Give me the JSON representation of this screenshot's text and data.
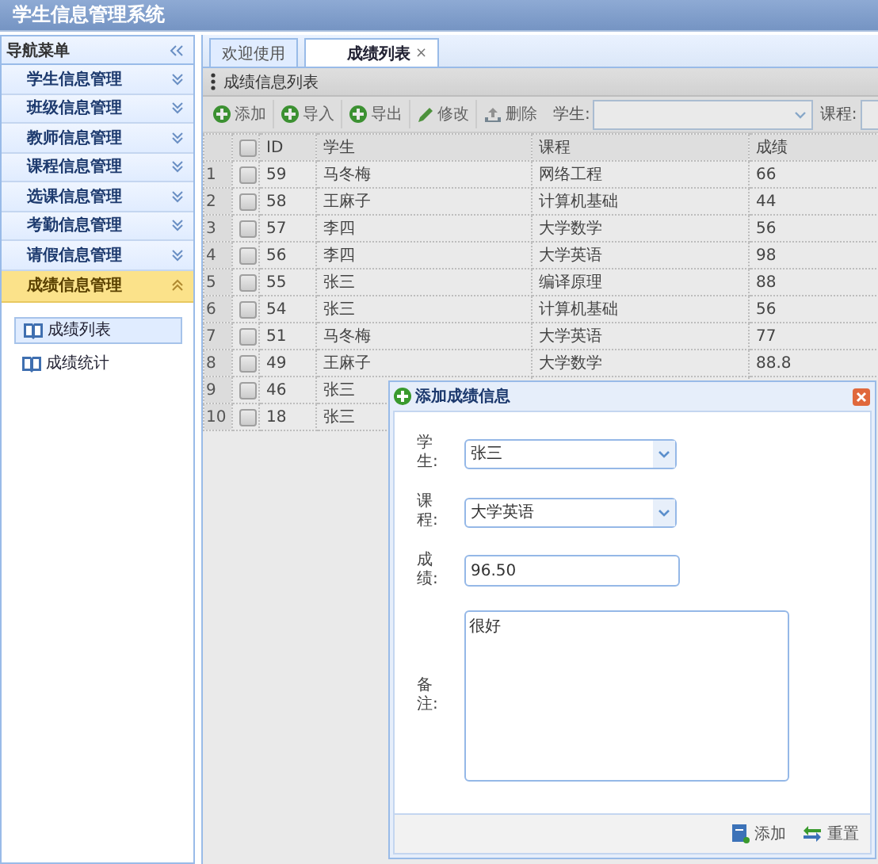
{
  "header": {
    "title": "学生信息管理系统"
  },
  "sidebar": {
    "title": "导航菜单",
    "items": [
      {
        "label": "学生信息管理",
        "expanded": false
      },
      {
        "label": "班级信息管理",
        "expanded": false
      },
      {
        "label": "教师信息管理",
        "expanded": false
      },
      {
        "label": "课程信息管理",
        "expanded": false
      },
      {
        "label": "选课信息管理",
        "expanded": false
      },
      {
        "label": "考勤信息管理",
        "expanded": false
      },
      {
        "label": "请假信息管理",
        "expanded": false
      },
      {
        "label": "成绩信息管理",
        "expanded": true,
        "children": [
          {
            "label": "成绩列表",
            "selected": true
          },
          {
            "label": "成绩统计",
            "selected": false
          }
        ]
      }
    ]
  },
  "tabs": [
    {
      "label": "欢迎使用",
      "selected": false
    },
    {
      "label": "成绩列表",
      "selected": true,
      "close": "×"
    }
  ],
  "panel": {
    "title": "成绩信息列表"
  },
  "toolbar": {
    "buttons": [
      {
        "label": "添加",
        "kind": "add"
      },
      {
        "label": "导入",
        "kind": "add"
      },
      {
        "label": "导出",
        "kind": "add"
      },
      {
        "label": "修改",
        "kind": "edit"
      },
      {
        "label": "删除",
        "kind": "delete"
      }
    ],
    "filters": [
      {
        "label": "学生:"
      },
      {
        "label": "课程:"
      }
    ]
  },
  "table": {
    "select_all_checked": false,
    "columns": [
      "ID",
      "学生",
      "课程",
      "成绩"
    ],
    "rows": [
      {
        "number": "1",
        "checked": false,
        "id": "59",
        "student": "马冬梅",
        "course": "网络工程",
        "score": "66"
      },
      {
        "number": "2",
        "checked": false,
        "id": "58",
        "student": "王麻子",
        "course": "计算机基础",
        "score": "44"
      },
      {
        "number": "3",
        "checked": false,
        "id": "57",
        "student": "李四",
        "course": "大学数学",
        "score": "56"
      },
      {
        "number": "4",
        "checked": false,
        "id": "56",
        "student": "李四",
        "course": "大学英语",
        "score": "98"
      },
      {
        "number": "5",
        "checked": false,
        "id": "55",
        "student": "张三",
        "course": "编译原理",
        "score": "88"
      },
      {
        "number": "6",
        "checked": false,
        "id": "54",
        "student": "张三",
        "course": "计算机基础",
        "score": "56"
      },
      {
        "number": "7",
        "checked": false,
        "id": "51",
        "student": "马冬梅",
        "course": "大学英语",
        "score": "77"
      },
      {
        "number": "8",
        "checked": false,
        "id": "49",
        "student": "王麻子",
        "course": "大学数学",
        "score": "88.8"
      },
      {
        "number": "9",
        "checked": false,
        "id": "46",
        "student": "张三"
      },
      {
        "number": "10",
        "checked": false,
        "id": "18",
        "student": "张三"
      }
    ]
  },
  "dialog": {
    "title": "添加成绩信息",
    "fields": [
      {
        "label": "学生:",
        "kind": "select",
        "value": "张三"
      },
      {
        "label": "课程:",
        "kind": "select",
        "value": "大学英语"
      },
      {
        "label": "成绩:",
        "kind": "input",
        "value": "96.50"
      },
      {
        "label": "备注:",
        "kind": "textarea",
        "value": "很好"
      }
    ],
    "buttons": [
      {
        "label": "添加",
        "kind": "save"
      },
      {
        "label": "重置",
        "kind": "reset"
      }
    ]
  }
}
